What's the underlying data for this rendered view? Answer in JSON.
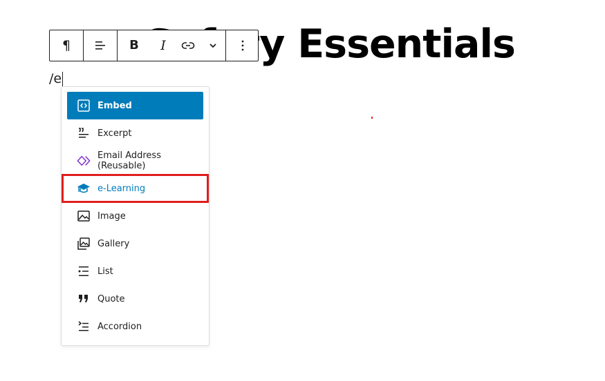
{
  "editor": {
    "post_title": "Safety Essentials",
    "paragraph_text": "/e"
  },
  "toolbar": {
    "paragraph_symbol": "¶",
    "bold_label": "B",
    "italic_label": "I",
    "more_label": "⋮"
  },
  "inserter": {
    "items": [
      {
        "label": "Embed",
        "icon": "embed-icon",
        "state": "selected"
      },
      {
        "label": "Excerpt",
        "icon": "excerpt-icon"
      },
      {
        "label": "Email Address (Reusable)",
        "icon": "reusable-block-icon"
      },
      {
        "label": "e-Learning",
        "icon": "graduation-cap-icon",
        "state": "highlighted"
      },
      {
        "label": "Image",
        "icon": "image-icon"
      },
      {
        "label": "Gallery",
        "icon": "gallery-icon"
      },
      {
        "label": "List",
        "icon": "list-icon"
      },
      {
        "label": "Quote",
        "icon": "quote-icon"
      },
      {
        "label": "Accordion",
        "icon": "accordion-icon"
      }
    ]
  },
  "colors": {
    "accent": "#007cba",
    "highlight_border": "#e11d1d",
    "reusable_icon": "#7b2ecf"
  }
}
